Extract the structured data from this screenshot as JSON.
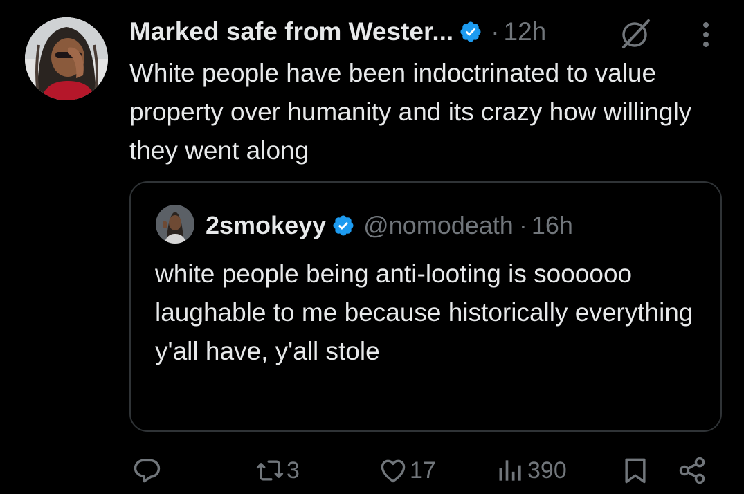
{
  "tweet": {
    "author_name": "Marked safe from Wester...",
    "separator": "·",
    "time": "12h",
    "text": "White people have been indoctrinated to value property over humanity and its crazy how willingly they went along",
    "icons": [
      "verified-badge-icon",
      "grok-icon",
      "more-icon"
    ]
  },
  "quoted_tweet": {
    "author_name": "2smokeyy",
    "handle": "@nomodeath",
    "separator": "·",
    "time": "16h",
    "text": "white people being anti-looting is soooooo laughable to me because historically everything y'all have, y'all stole"
  },
  "actions": {
    "reply_count": "",
    "retweet_count": "3",
    "like_count": "17",
    "views_count": "390",
    "icons": [
      "reply-icon",
      "retweet-icon",
      "like-icon",
      "views-icon",
      "bookmark-icon",
      "share-icon"
    ]
  },
  "colors": {
    "background": "#000000",
    "text_primary": "#e7e9ea",
    "text_secondary": "#71767b",
    "verified_blue": "#1d9bf0",
    "border": "#2f3336"
  }
}
